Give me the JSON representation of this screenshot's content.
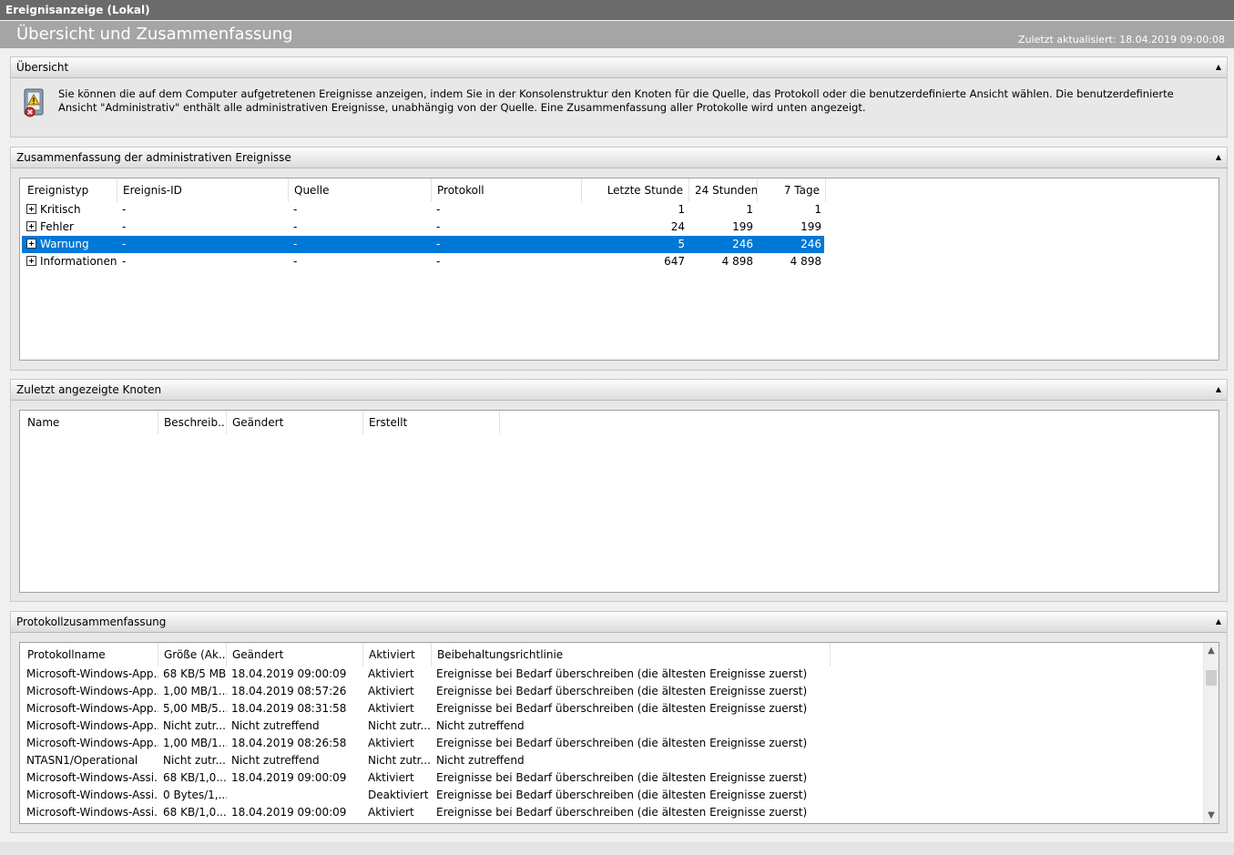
{
  "window": {
    "title": "Ereignisanzeige (Lokal)"
  },
  "header": {
    "page_title": "Übersicht und Zusammenfassung",
    "updated": "Zuletzt aktualisiert: 18.04.2019 09:00:08"
  },
  "overview": {
    "title": "Übersicht",
    "text": "Sie können die auf dem Computer aufgetretenen Ereignisse anzeigen, indem Sie in der Konsolenstruktur den Knoten für die Quelle, das Protokoll oder die benutzerdefinierte Ansicht wählen. Die benutzerdefinierte Ansicht \"Administrativ\" enthält alle administrativen Ereignisse, unabhängig von der Quelle. Eine Zusammenfassung aller Protokolle wird unten angezeigt."
  },
  "admin_summary": {
    "title": "Zusammenfassung der administrativen Ereignisse",
    "columns": [
      "Ereignistyp",
      "Ereignis-ID",
      "Quelle",
      "Protokoll",
      "Letzte Stunde",
      "24 Stunden",
      "7 Tage"
    ],
    "rows": [
      {
        "type": "Kritisch",
        "id": "-",
        "source": "-",
        "log": "-",
        "last_hour": "1",
        "h24": "1",
        "d7": "1",
        "selected": false
      },
      {
        "type": "Fehler",
        "id": "-",
        "source": "-",
        "log": "-",
        "last_hour": "24",
        "h24": "199",
        "d7": "199",
        "selected": false
      },
      {
        "type": "Warnung",
        "id": "-",
        "source": "-",
        "log": "-",
        "last_hour": "5",
        "h24": "246",
        "d7": "246",
        "selected": true
      },
      {
        "type": "Informationen",
        "id": "-",
        "source": "-",
        "log": "-",
        "last_hour": "647",
        "h24": "4 898",
        "d7": "4 898",
        "selected": false
      }
    ]
  },
  "recent_nodes": {
    "title": "Zuletzt angezeigte Knoten",
    "columns": [
      "Name",
      "Beschreib...",
      "Geändert",
      "Erstellt"
    ]
  },
  "log_summary": {
    "title": "Protokollzusammenfassung",
    "columns": [
      "Protokollname",
      "Größe (Ak...",
      "Geändert",
      "Aktiviert",
      "Beibehaltungsrichtlinie"
    ],
    "rows": [
      {
        "name": "Microsoft-Windows-App...",
        "size": "68 KB/5 MB",
        "modified": "18.04.2019 09:00:09",
        "enabled": "Aktiviert",
        "policy": "Ereignisse bei Bedarf überschreiben (die ältesten Ereignisse zuerst)"
      },
      {
        "name": "Microsoft-Windows-App...",
        "size": "1,00 MB/1...",
        "modified": "18.04.2019 08:57:26",
        "enabled": "Aktiviert",
        "policy": "Ereignisse bei Bedarf überschreiben (die ältesten Ereignisse zuerst)"
      },
      {
        "name": "Microsoft-Windows-App...",
        "size": "5,00 MB/5...",
        "modified": "18.04.2019 08:31:58",
        "enabled": "Aktiviert",
        "policy": "Ereignisse bei Bedarf überschreiben (die ältesten Ereignisse zuerst)"
      },
      {
        "name": "Microsoft-Windows-App...",
        "size": "Nicht zutr...",
        "modified": "Nicht zutreffend",
        "enabled": "Nicht zutr...",
        "policy": "Nicht zutreffend"
      },
      {
        "name": "Microsoft-Windows-App...",
        "size": "1,00 MB/1...",
        "modified": "18.04.2019 08:26:58",
        "enabled": "Aktiviert",
        "policy": "Ereignisse bei Bedarf überschreiben (die ältesten Ereignisse zuerst)"
      },
      {
        "name": "NTASN1/Operational",
        "size": "Nicht zutr...",
        "modified": "Nicht zutreffend",
        "enabled": "Nicht zutr...",
        "policy": "Nicht zutreffend"
      },
      {
        "name": "Microsoft-Windows-Assi...",
        "size": "68 KB/1,0...",
        "modified": "18.04.2019 09:00:09",
        "enabled": "Aktiviert",
        "policy": "Ereignisse bei Bedarf überschreiben (die ältesten Ereignisse zuerst)"
      },
      {
        "name": "Microsoft-Windows-Assi...",
        "size": "0 Bytes/1,...",
        "modified": "",
        "enabled": "Deaktiviert",
        "policy": "Ereignisse bei Bedarf überschreiben (die ältesten Ereignisse zuerst)"
      },
      {
        "name": "Microsoft-Windows-Assi...",
        "size": "68 KB/1,0...",
        "modified": "18.04.2019 09:00:09",
        "enabled": "Aktiviert",
        "policy": "Ereignisse bei Bedarf überschreiben (die ältesten Ereignisse zuerst)"
      }
    ]
  },
  "colors": {
    "selection": "#0078d7",
    "titlebar": "#6b6b6b",
    "headerband": "#a5a5a5"
  }
}
